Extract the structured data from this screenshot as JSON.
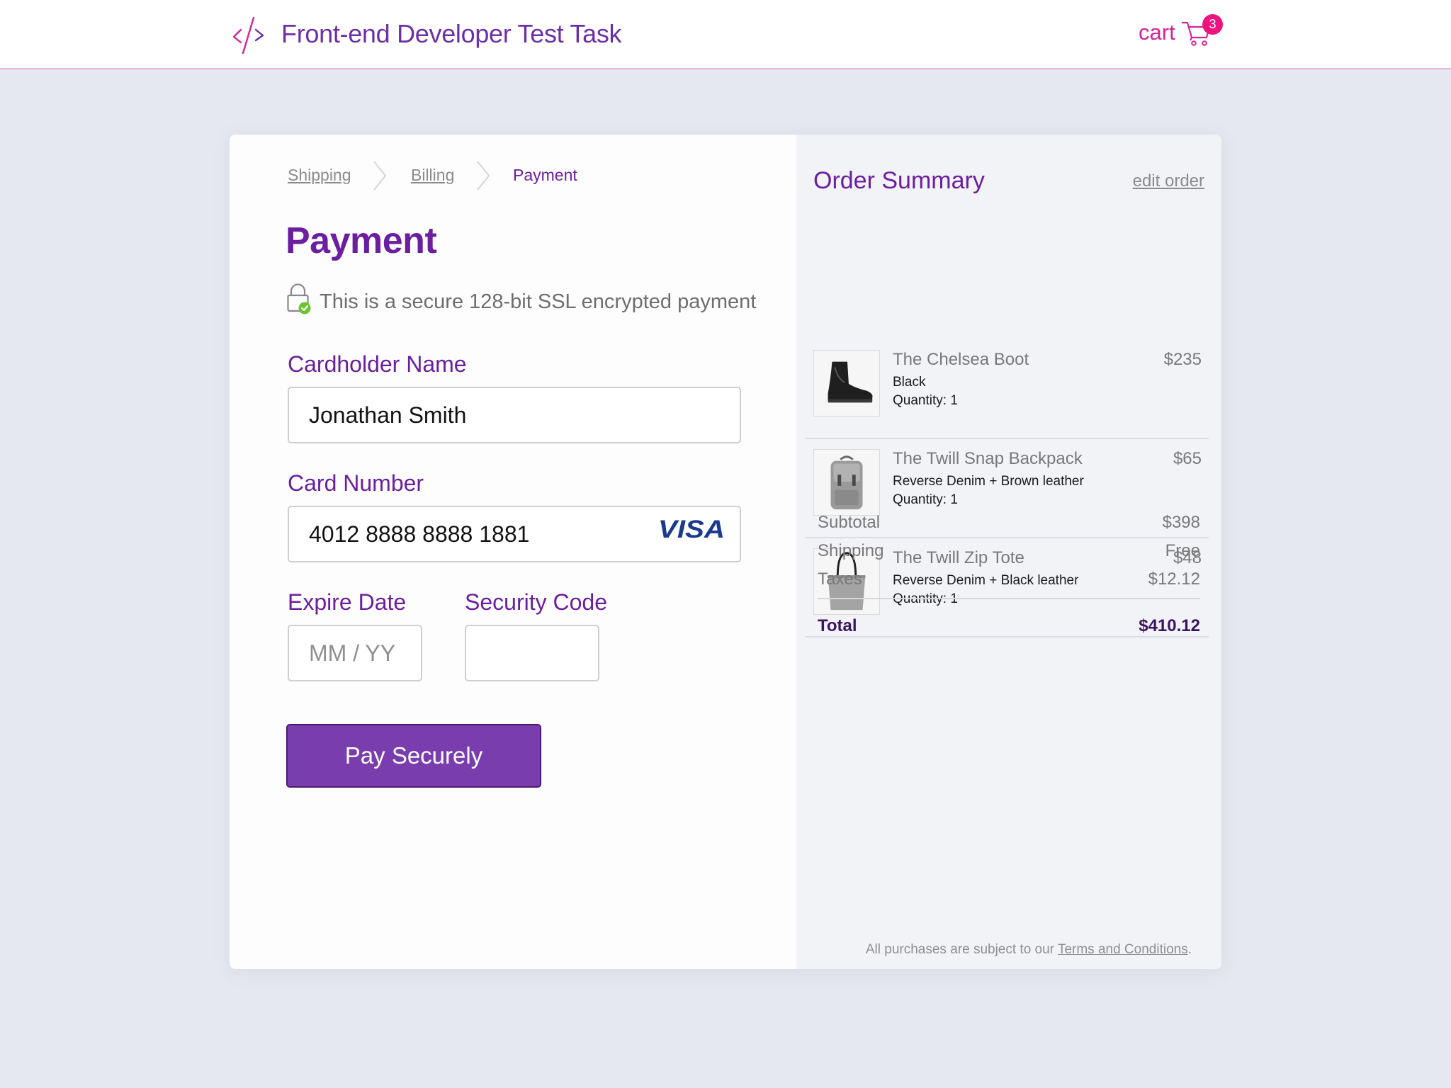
{
  "header": {
    "title": "Front-end Developer Test Task",
    "cart_label": "cart",
    "cart_count": "3"
  },
  "steps": [
    {
      "label": "Shipping",
      "state": "done"
    },
    {
      "label": "Billing",
      "state": "done"
    },
    {
      "label": "Payment",
      "state": "active"
    }
  ],
  "payment": {
    "heading": "Payment",
    "secure_note": "This is a secure 128-bit SSL encrypted payment",
    "cardholder": {
      "label": "Cardholder Name",
      "value": "Jonathan Smith"
    },
    "card_number": {
      "label": "Card Number",
      "value": "4012 8888 8888 1881",
      "brand": "VISA"
    },
    "expiry": {
      "label": "Expire Date",
      "placeholder": "MM / YY",
      "value": ""
    },
    "security_code": {
      "label": "Security Code",
      "value": ""
    },
    "submit_label": "Pay Securely"
  },
  "summary": {
    "title": "Order Summary",
    "edit_label": "edit order",
    "items": [
      {
        "name": "The Chelsea Boot",
        "variant": "Black",
        "quantity": "Quantity: 1",
        "price": "$235",
        "icon": "boot-icon"
      },
      {
        "name": "The Twill Snap Backpack",
        "variant": "Reverse Denim + Brown leather",
        "quantity": "Quantity: 1",
        "price": "$65",
        "icon": "backpack-icon"
      },
      {
        "name": "The Twill Zip Tote",
        "variant": "Reverse Denim + Black leather",
        "quantity": "Quantity: 1",
        "price": "$48",
        "icon": "tote-icon"
      }
    ],
    "subtotal": {
      "label": "Subtotal",
      "value": "$398"
    },
    "shipping": {
      "label": "Shipping",
      "value": "Free"
    },
    "taxes": {
      "label": "Taxes",
      "value": "$12.12"
    },
    "total": {
      "label": "Total",
      "value": "$410.12"
    },
    "legal_text": "All purchases are subject to our",
    "legal_link": "Terms and Conditions",
    "legal_end": "."
  },
  "colors": {
    "brand_purple": "#6b1f9e",
    "button_purple": "#7a3dad",
    "accent_pink": "#d1249a",
    "badge_pink": "#f0127f",
    "secure_green": "#68c52c"
  }
}
